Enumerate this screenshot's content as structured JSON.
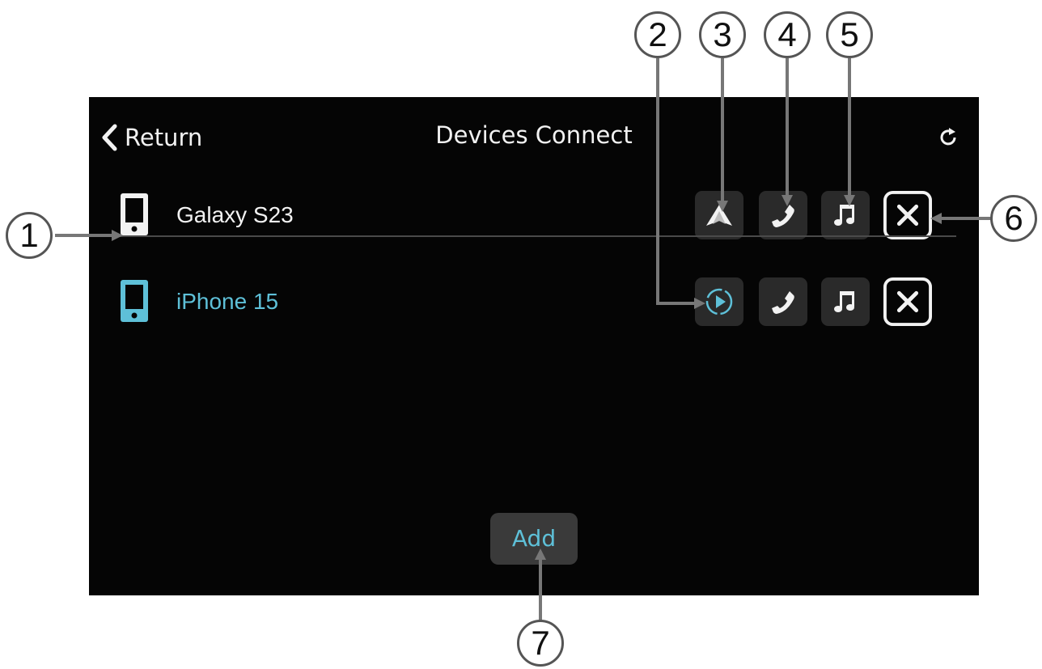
{
  "header": {
    "back_label": "Return",
    "title": "Devices Connect",
    "refresh_icon": "refresh-icon",
    "back_icon": "chevron-left-icon"
  },
  "devices": [
    {
      "name": "Galaxy S23",
      "icon": "phone-icon",
      "color": "#f2f2f2",
      "projection_icon": "android-auto-icon"
    },
    {
      "name": "iPhone 15",
      "icon": "phone-icon",
      "color": "#5ec0d8",
      "projection_icon": "carplay-icon"
    }
  ],
  "device_actions": [
    "phone-call-icon",
    "music-note-icon",
    "close-x-icon"
  ],
  "add_button": {
    "label": "Add"
  },
  "callouts": [
    "1",
    "2",
    "3",
    "4",
    "5",
    "6",
    "7"
  ],
  "colors": {
    "background": "#050505",
    "accent": "#5ec0d8",
    "button": "#2a2a2a"
  }
}
